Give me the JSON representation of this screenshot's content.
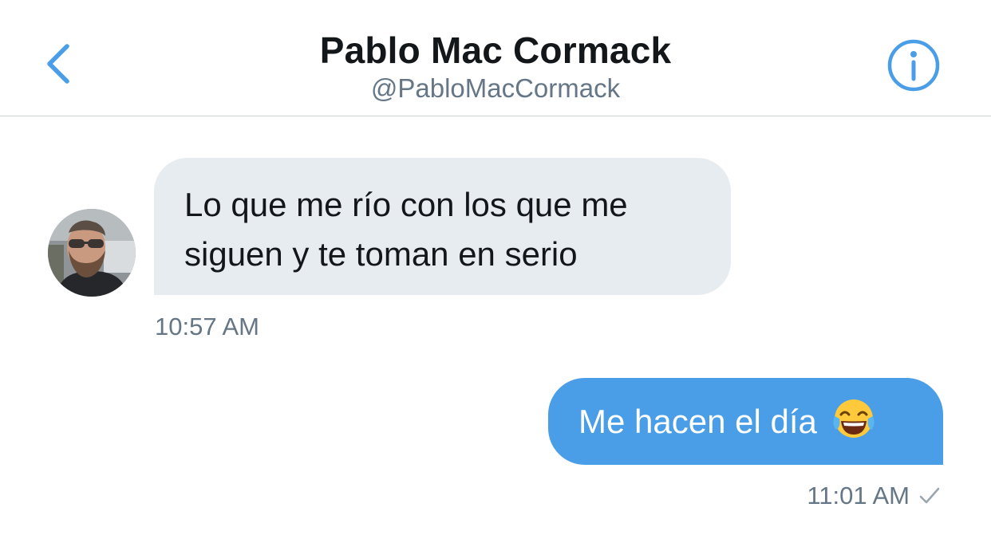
{
  "header": {
    "back_icon": "chevron-left-icon",
    "contact_name": "Pablo Mac Cormack",
    "contact_handle": "@PabloMacCormack",
    "info_icon": "info-icon",
    "accent_color": "#4a9de7"
  },
  "conversation": {
    "messages": [
      {
        "direction": "incoming",
        "text": "Lo que me río con los que me\nsiguen y te toman en serio",
        "time": "10:57 AM",
        "bubble_color": "#e6ecf0"
      },
      {
        "direction": "outgoing",
        "text": "Me hacen el día",
        "emoji": "face-with-tears-of-joy-emoji",
        "time": "11:01 AM",
        "status_icon": "sent-check-icon",
        "bubble_color": "#4a9de7"
      }
    ]
  }
}
